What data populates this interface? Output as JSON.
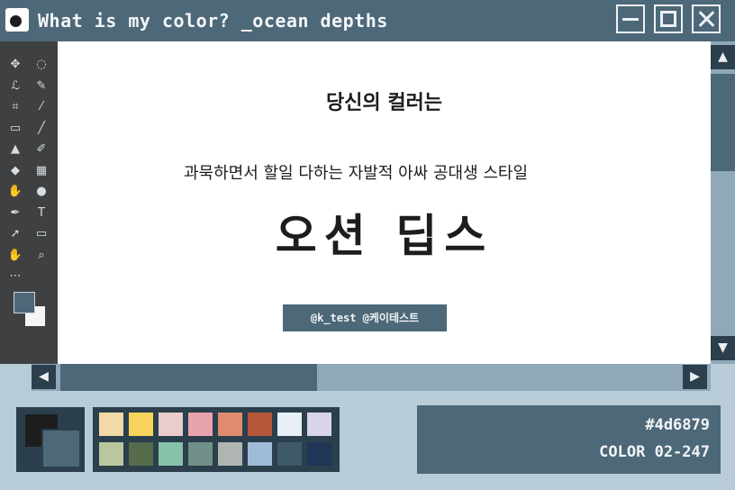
{
  "window": {
    "title": "What is my color? _ocean depths",
    "controls": [
      "minimize",
      "maximize",
      "close"
    ]
  },
  "toolbar": {
    "tools": [
      {
        "icon": "move-icon",
        "glyph": "✥"
      },
      {
        "icon": "marquee-icon",
        "glyph": "◌"
      },
      {
        "icon": "lasso-icon",
        "glyph": "ℒ"
      },
      {
        "icon": "quick-select-icon",
        "glyph": "✎"
      },
      {
        "icon": "crop-icon",
        "glyph": "⌗"
      },
      {
        "icon": "eyedropper-icon",
        "glyph": "⁄"
      },
      {
        "icon": "patch-icon",
        "glyph": "▭"
      },
      {
        "icon": "brush-icon",
        "glyph": "╱"
      },
      {
        "icon": "stamp-icon",
        "glyph": "▲"
      },
      {
        "icon": "history-brush-icon",
        "glyph": "✐"
      },
      {
        "icon": "eraser-icon",
        "glyph": "◆"
      },
      {
        "icon": "gradient-icon",
        "glyph": "▦"
      },
      {
        "icon": "smudge-icon",
        "glyph": "✋"
      },
      {
        "icon": "dodge-icon",
        "glyph": "●"
      },
      {
        "icon": "pen-icon",
        "glyph": "✒"
      },
      {
        "icon": "type-icon",
        "glyph": "T"
      },
      {
        "icon": "path-select-icon",
        "glyph": "➚"
      },
      {
        "icon": "rectangle-icon",
        "glyph": "▭"
      },
      {
        "icon": "hand-icon",
        "glyph": "✋"
      },
      {
        "icon": "zoom-icon",
        "glyph": "⌕"
      },
      {
        "icon": "more-icon",
        "glyph": "⋯"
      }
    ],
    "foreground_color": "#4d6879",
    "background_color": "#f5f5f5"
  },
  "canvas": {
    "heading": "당신의 컬러는",
    "description": "과묵하면서 할일 다하는 자발적 아싸 공대생 스타일",
    "color_name": "오션 딥스",
    "credit": "@k_test @케이테스트"
  },
  "colorbox": {
    "primary": "#1d1d1d",
    "secondary": "#4d6879"
  },
  "palette": {
    "row1": [
      "#f2d9a8",
      "#f7d35c",
      "#e9cdcd",
      "#e9a3ad",
      "#de8b6f",
      "#b6563b",
      "#e9eff7",
      "#d9d5e9"
    ],
    "row2": [
      "#bac79e",
      "#566b4b",
      "#86c1a9",
      "#6f8f88",
      "#b1b5b2",
      "#a0bbd8",
      "#3e5a6a",
      "#1f3656"
    ]
  },
  "info": {
    "hex": "#4d6879",
    "code": "COLOR 02-247"
  }
}
